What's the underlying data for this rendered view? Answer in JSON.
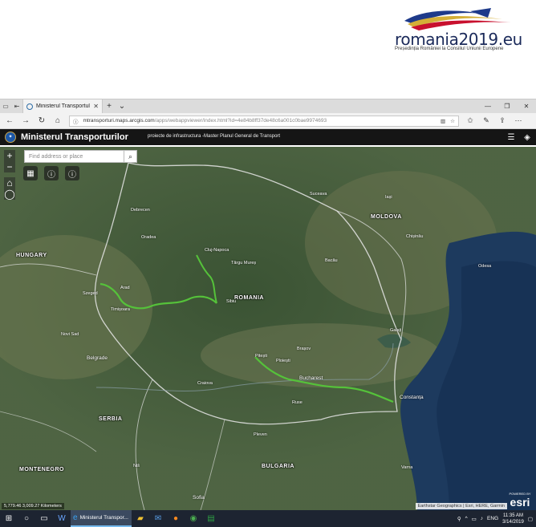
{
  "branding": {
    "title": "romania2019.eu",
    "subtitle": "Președinția României la Consiliul Uniunii Europene"
  },
  "browser": {
    "tab_title": "Ministerul Transportulu",
    "url_prefix": "mtransporturi.maps.arcgis.com",
    "url_path": "/apps/webappviewer/index.html?id=4e84b8ff37de48c6a001c0bae9974693"
  },
  "app": {
    "title": "Ministerul Transporturilor",
    "subtitle": "proiecte de infrastructura -Master Planul General de Transport",
    "search_placeholder": "Find address or place"
  },
  "map": {
    "countries": [
      "HUNGARY",
      "ROMANIA",
      "MOLDOVA",
      "SERBIA",
      "BULGARIA",
      "MONTENEGRO"
    ],
    "cities": [
      "Cluj-Napoca",
      "Oradea",
      "Arad",
      "Timișoara",
      "Sibiu",
      "Brașov",
      "Pitești",
      "Ploiești",
      "Bucharest",
      "Constanța",
      "Iași",
      "Chișinău",
      "Odesa",
      "Belgrade",
      "Novi Sad",
      "Craiova",
      "Sofia",
      "Debrecen",
      "Szeged",
      "Galați",
      "Bacău",
      "Niš",
      "Pleven",
      "Varna",
      "Ruse",
      "Târgu Mureș",
      "Suceava"
    ],
    "coords": "5,779.46 3,009.27 Kilometers",
    "attribution": "Earthstar Geographics | Esri, HERE, Garmin",
    "esri_label": "esri",
    "esri_powered": "POWERED BY"
  },
  "taskbar": {
    "app_label": "Ministerul Transpor...",
    "lang": "ENG",
    "time": "11:35 AM",
    "date": "3/14/2019"
  }
}
